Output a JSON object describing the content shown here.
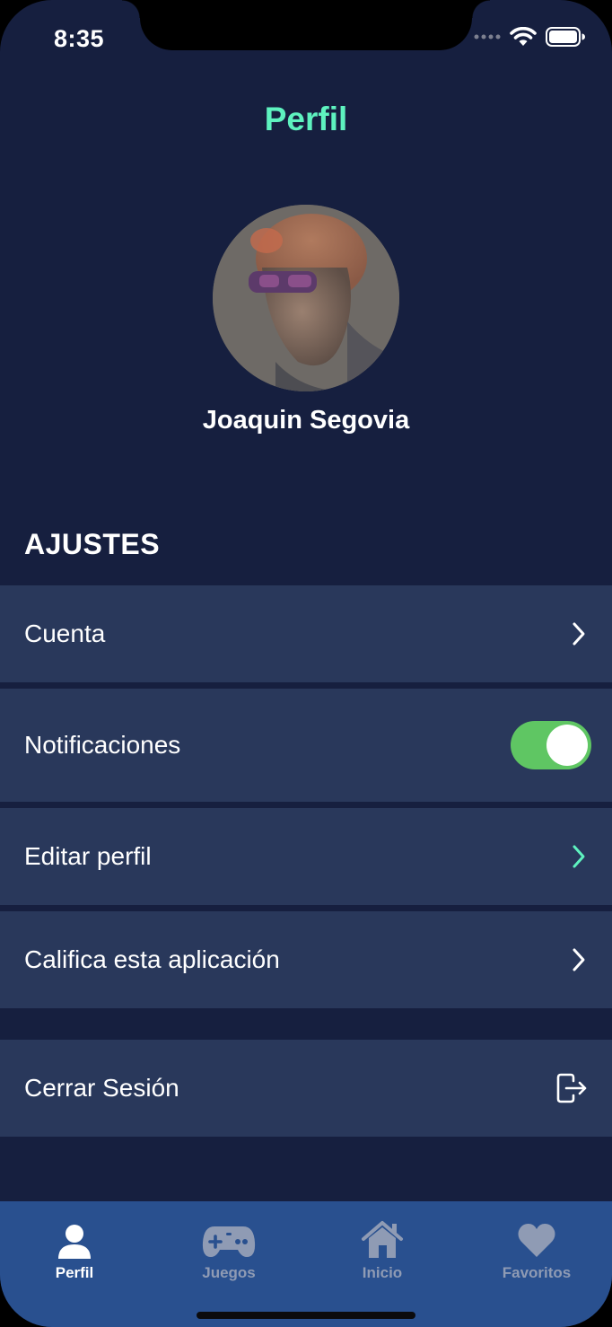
{
  "status_bar": {
    "time": "8:35"
  },
  "header": {
    "title": "Perfil"
  },
  "profile": {
    "name": "Joaquin Segovia"
  },
  "settings": {
    "section_title": "AJUSTES",
    "items": [
      {
        "label": "Cuenta"
      },
      {
        "label": "Notificaciones",
        "toggle_on": true
      },
      {
        "label": "Editar perfil"
      },
      {
        "label": "Califica esta aplicación"
      }
    ],
    "logout_label": "Cerrar Sesión"
  },
  "tabbar": {
    "tabs": [
      {
        "label": "Perfil",
        "icon": "person-icon",
        "active": true
      },
      {
        "label": "Juegos",
        "icon": "gamepad-icon",
        "active": false
      },
      {
        "label": "Inicio",
        "icon": "home-icon",
        "active": false
      },
      {
        "label": "Favoritos",
        "icon": "heart-icon",
        "active": false
      }
    ]
  },
  "colors": {
    "background": "#161f3f",
    "row": "#29385b",
    "accent": "#5ef2bf",
    "toggle_on": "#5fc663",
    "tabbar": "#29508f"
  }
}
